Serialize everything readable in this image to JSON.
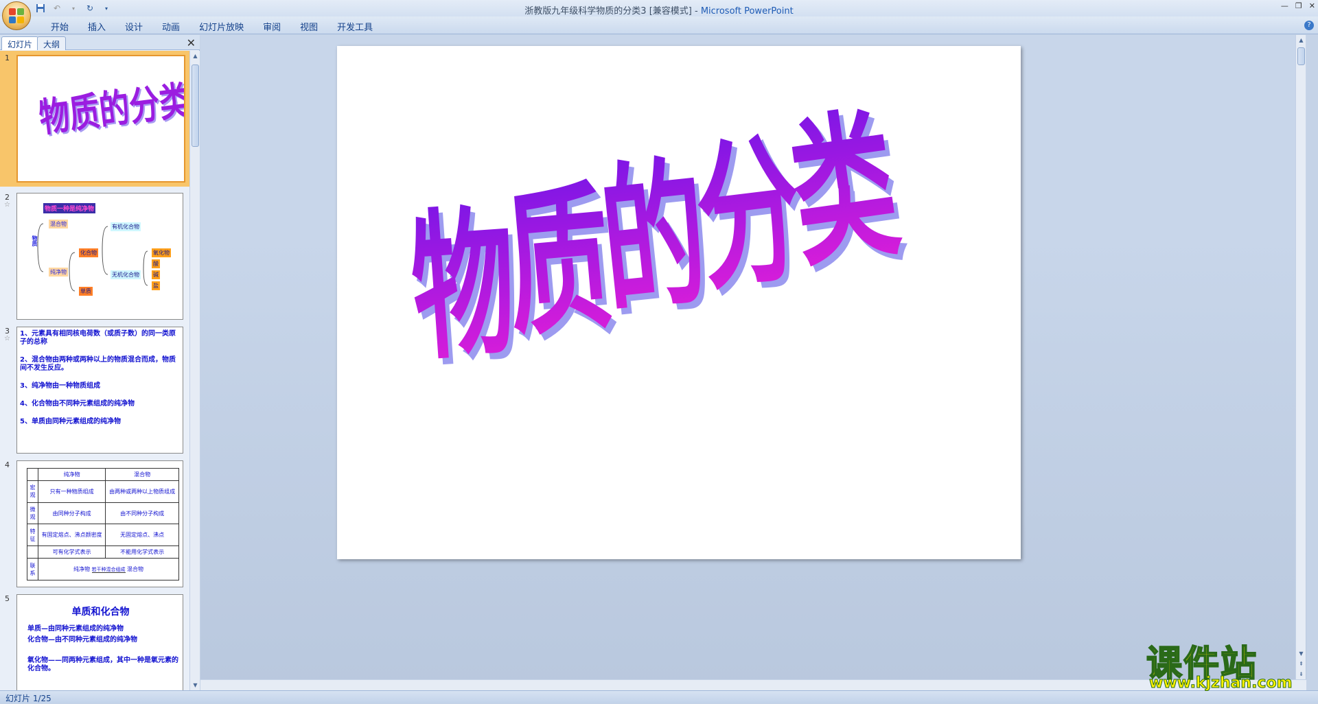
{
  "window": {
    "title": "浙教版九年级科学物质的分类3 [兼容模式] - ",
    "app_name": "Microsoft PowerPoint"
  },
  "menu": {
    "tabs": [
      "开始",
      "插入",
      "设计",
      "动画",
      "幻灯片放映",
      "审阅",
      "视图",
      "开发工具"
    ]
  },
  "pane": {
    "tab_slides": "幻灯片",
    "tab_outline": "大纲",
    "close": "✕"
  },
  "thumbnails": {
    "s1": {
      "num": "1",
      "title": "物质的分类"
    },
    "s2": {
      "num": "2",
      "header": "物质一种是纯净物",
      "root": "物质",
      "mix": "混合物",
      "pure": "纯净物",
      "compound": "化合物",
      "element": "单质",
      "organic": "有机化合物",
      "inorganic": "无机化合物",
      "oxide": "氧化物",
      "acid": "酸",
      "base": "碱",
      "salt": "盐"
    },
    "s3": {
      "num": "3",
      "lines": [
        "1、元素具有相同核电荷数（或质子数）的同一类原子的总称",
        "2、混合物由两种或两种以上的物质混合而成，物质间不发生反应。",
        "3、纯净物由一种物质组成",
        "4、化合物由不同种元素组成的纯净物",
        "5、单质由同种元素组成的纯净物"
      ]
    },
    "s4": {
      "num": "4",
      "col1": "纯净物",
      "col2": "混合物",
      "rows": [
        {
          "label": "宏观",
          "a": "只有一种物质组成",
          "b": "由两种或两种以上物质组成"
        },
        {
          "label": "微观",
          "a": "由同种分子构成",
          "b": "由不同种分子构成"
        },
        {
          "label": "特征",
          "a": "有固定熔点、沸点颜密度",
          "b": "无固定熔点、沸点"
        },
        {
          "label": "",
          "a": "可有化学式表示",
          "b": "不能用化学式表示"
        },
        {
          "label": "联系",
          "a": "纯净物",
          "b": "混合物",
          "mid": "若干种混合组成"
        }
      ]
    },
    "s5": {
      "num": "5",
      "heading": "单质和化合物",
      "lines": [
        "单质—由同种元素组成的纯净物",
        "化合物—由不同种元素组成的纯净物",
        "氧化物——同两种元素组成，其中一种是氧元素的化合物。"
      ]
    }
  },
  "slide": {
    "title_chars": [
      "物",
      "质",
      "的",
      "分",
      "类"
    ],
    "fill_top": "#7a16e6",
    "fill_bottom": "#e21ed8",
    "shadow": "#9d9bf0"
  },
  "status": {
    "slide_indicator": "幻灯片 1/25"
  },
  "watermark": {
    "name": "课件站",
    "url": "www.kjzhan.com"
  }
}
